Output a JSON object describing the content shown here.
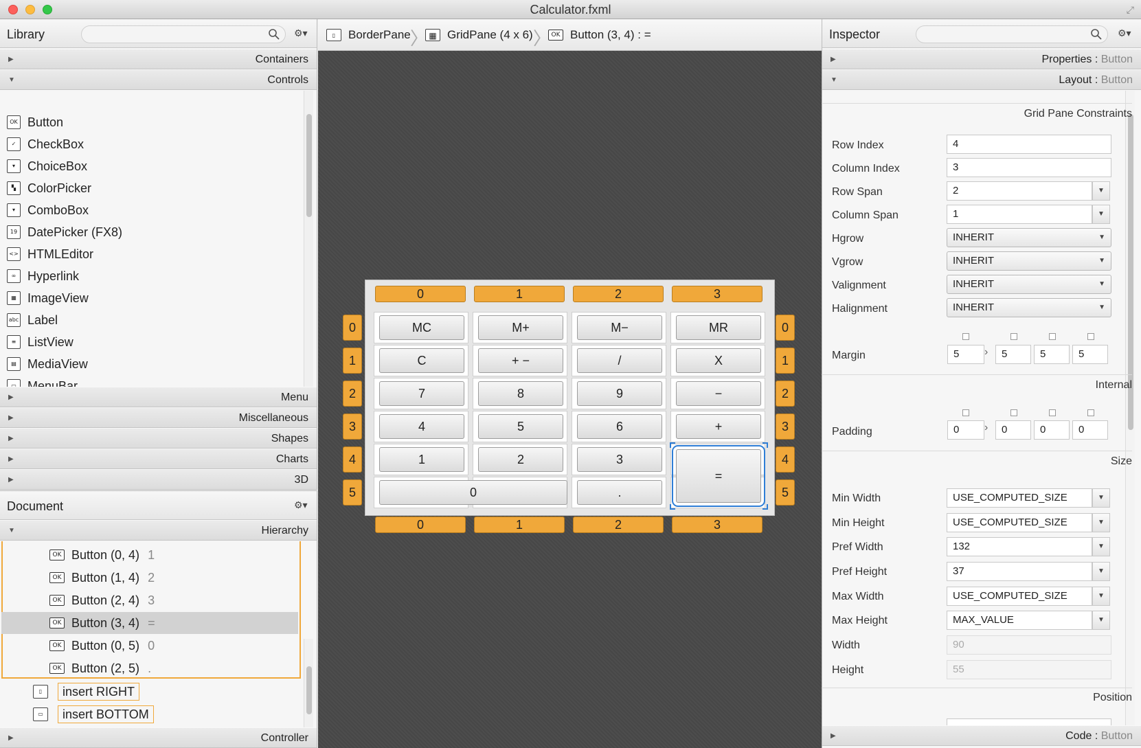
{
  "window": {
    "title": "Calculator.fxml"
  },
  "library": {
    "title": "Library",
    "sections_top": [
      {
        "label": "Containers",
        "expanded": false
      },
      {
        "label": "Controls",
        "expanded": true
      }
    ],
    "controls": [
      {
        "label": "Button",
        "icon": "button-icon",
        "glyph": "OK"
      },
      {
        "label": "CheckBox",
        "icon": "checkbox-icon",
        "glyph": "✓"
      },
      {
        "label": "ChoiceBox",
        "icon": "choicebox-icon",
        "glyph": "▾"
      },
      {
        "label": "ColorPicker",
        "icon": "colorpicker-icon",
        "glyph": "▚"
      },
      {
        "label": "ComboBox",
        "icon": "combobox-icon",
        "glyph": "▾"
      },
      {
        "label": "DatePicker  (FX8)",
        "icon": "datepicker-icon",
        "glyph": "19"
      },
      {
        "label": "HTMLEditor",
        "icon": "htmleditor-icon",
        "glyph": "<>"
      },
      {
        "label": "Hyperlink",
        "icon": "hyperlink-icon",
        "glyph": "∞"
      },
      {
        "label": "ImageView",
        "icon": "imageview-icon",
        "glyph": "▦"
      },
      {
        "label": "Label",
        "icon": "label-icon",
        "glyph": "abc"
      },
      {
        "label": "ListView",
        "icon": "listview-icon",
        "glyph": "≡"
      },
      {
        "label": "MediaView",
        "icon": "mediaview-icon",
        "glyph": "▤"
      },
      {
        "label": "MenuBar",
        "icon": "menubar-icon",
        "glyph": "▭"
      }
    ],
    "sections_bottom": [
      "Menu",
      "Miscellaneous",
      "Shapes",
      "Charts",
      "3D"
    ]
  },
  "document": {
    "title": "Document",
    "hierarchy_label": "Hierarchy",
    "controller_label": "Controller",
    "rows": [
      {
        "label": "Button (0, 4)",
        "value": "1",
        "selected": false
      },
      {
        "label": "Button (1, 4)",
        "value": "2",
        "selected": false
      },
      {
        "label": "Button (2, 4)",
        "value": "3",
        "selected": false
      },
      {
        "label": "Button (3, 4)",
        "value": "=",
        "selected": true
      },
      {
        "label": "Button (0, 5)",
        "value": "0",
        "selected": false
      },
      {
        "label": "Button (2, 5)",
        "value": ".",
        "selected": false
      }
    ],
    "inserts": [
      "insert RIGHT",
      "insert BOTTOM"
    ]
  },
  "breadcrumb": [
    {
      "label": "BorderPane",
      "icon": "borderpane-icon"
    },
    {
      "label": "GridPane (4 x 6)",
      "icon": "gridpane-icon"
    },
    {
      "label": "Button (3, 4) : =",
      "icon": "button-icon"
    }
  ],
  "grid": {
    "col_headers": [
      "0",
      "1",
      "2",
      "3"
    ],
    "row_headers": [
      "0",
      "1",
      "2",
      "3",
      "4",
      "5"
    ],
    "buttons": [
      [
        "MC",
        "M+",
        "M−",
        "MR"
      ],
      [
        "C",
        "+ −",
        "/",
        "X"
      ],
      [
        "7",
        "8",
        "9",
        "−"
      ],
      [
        "4",
        "5",
        "6",
        "+"
      ],
      [
        "1",
        "2",
        "3",
        "="
      ],
      [
        "0",
        "",
        "."
      ]
    ]
  },
  "inspector": {
    "title": "Inspector",
    "properties": {
      "label": "Properties",
      "target": "Button"
    },
    "layout": {
      "label": "Layout",
      "target": "Button"
    },
    "code": {
      "label": "Code",
      "target": "Button"
    },
    "grid_constraints_label": "Grid Pane Constraints",
    "fields": {
      "row_index": {
        "label": "Row Index",
        "value": "4"
      },
      "column_index": {
        "label": "Column Index",
        "value": "3"
      },
      "row_span": {
        "label": "Row Span",
        "value": "2"
      },
      "column_span": {
        "label": "Column Span",
        "value": "1"
      },
      "hgrow": {
        "label": "Hgrow",
        "value": "INHERIT"
      },
      "vgrow": {
        "label": "Vgrow",
        "value": "INHERIT"
      },
      "valignment": {
        "label": "Valignment",
        "value": "INHERIT"
      },
      "halignment": {
        "label": "Halignment",
        "value": "INHERIT"
      },
      "margin": {
        "label": "Margin",
        "values": [
          "5",
          "5",
          "5",
          "5"
        ]
      }
    },
    "internal_label": "Internal",
    "padding": {
      "label": "Padding",
      "values": [
        "0",
        "0",
        "0",
        "0"
      ]
    },
    "size_label": "Size",
    "size_fields": {
      "min_width": {
        "label": "Min Width",
        "value": "USE_COMPUTED_SIZE"
      },
      "min_height": {
        "label": "Min Height",
        "value": "USE_COMPUTED_SIZE"
      },
      "pref_width": {
        "label": "Pref Width",
        "value": "132"
      },
      "pref_height": {
        "label": "Pref Height",
        "value": "37"
      },
      "max_width": {
        "label": "Max Width",
        "value": "USE_COMPUTED_SIZE"
      },
      "max_height": {
        "label": "Max Height",
        "value": "MAX_VALUE"
      },
      "width": {
        "label": "Width",
        "value": "90"
      },
      "height": {
        "label": "Height",
        "value": "55"
      }
    },
    "position_label": "Position",
    "separator": ":"
  },
  "colors": {
    "accent_orange": "#f0a83a",
    "selection_blue": "#2e7ed6",
    "canvas": "#4a4a4a"
  }
}
